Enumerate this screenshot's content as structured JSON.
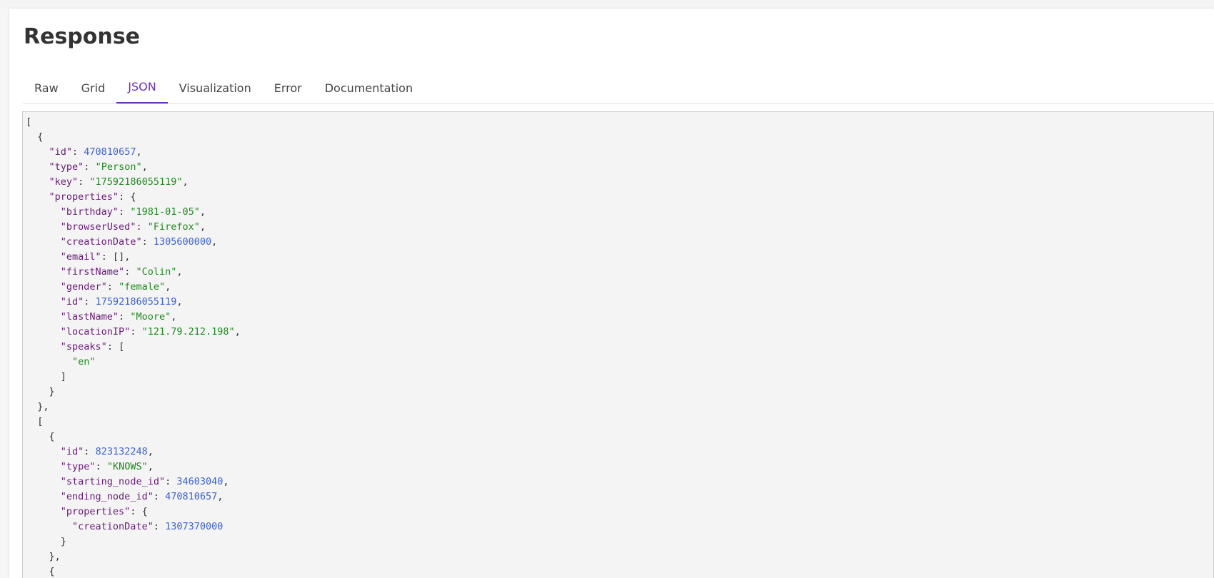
{
  "panel": {
    "title": "Response"
  },
  "tabs": [
    {
      "label": "Raw",
      "active": false
    },
    {
      "label": "Grid",
      "active": false
    },
    {
      "label": "JSON",
      "active": true
    },
    {
      "label": "Visualization",
      "active": false
    },
    {
      "label": "Error",
      "active": false
    },
    {
      "label": "Documentation",
      "active": false
    }
  ],
  "colors": {
    "accent": "#6b2fbf",
    "json_key": "#6a1b7a",
    "json_string": "#1d8a1d",
    "json_number": "#3b62d6"
  },
  "json_lines": [
    [
      {
        "t": "p",
        "v": "["
      }
    ],
    [
      {
        "t": "p",
        "v": "  {"
      }
    ],
    [
      {
        "t": "p",
        "v": "    "
      },
      {
        "t": "k",
        "v": "\"id\""
      },
      {
        "t": "p",
        "v": ": "
      },
      {
        "t": "n",
        "v": "470810657"
      },
      {
        "t": "p",
        "v": ","
      }
    ],
    [
      {
        "t": "p",
        "v": "    "
      },
      {
        "t": "k",
        "v": "\"type\""
      },
      {
        "t": "p",
        "v": ": "
      },
      {
        "t": "s",
        "v": "\"Person\""
      },
      {
        "t": "p",
        "v": ","
      }
    ],
    [
      {
        "t": "p",
        "v": "    "
      },
      {
        "t": "k",
        "v": "\"key\""
      },
      {
        "t": "p",
        "v": ": "
      },
      {
        "t": "s",
        "v": "\"17592186055119\""
      },
      {
        "t": "p",
        "v": ","
      }
    ],
    [
      {
        "t": "p",
        "v": "    "
      },
      {
        "t": "k",
        "v": "\"properties\""
      },
      {
        "t": "p",
        "v": ": {"
      }
    ],
    [
      {
        "t": "p",
        "v": "      "
      },
      {
        "t": "k",
        "v": "\"birthday\""
      },
      {
        "t": "p",
        "v": ": "
      },
      {
        "t": "s",
        "v": "\"1981-01-05\""
      },
      {
        "t": "p",
        "v": ","
      }
    ],
    [
      {
        "t": "p",
        "v": "      "
      },
      {
        "t": "k",
        "v": "\"browserUsed\""
      },
      {
        "t": "p",
        "v": ": "
      },
      {
        "t": "s",
        "v": "\"Firefox\""
      },
      {
        "t": "p",
        "v": ","
      }
    ],
    [
      {
        "t": "p",
        "v": "      "
      },
      {
        "t": "k",
        "v": "\"creationDate\""
      },
      {
        "t": "p",
        "v": ": "
      },
      {
        "t": "n",
        "v": "1305600000"
      },
      {
        "t": "p",
        "v": ","
      }
    ],
    [
      {
        "t": "p",
        "v": "      "
      },
      {
        "t": "k",
        "v": "\"email\""
      },
      {
        "t": "p",
        "v": ": [],"
      }
    ],
    [
      {
        "t": "p",
        "v": "      "
      },
      {
        "t": "k",
        "v": "\"firstName\""
      },
      {
        "t": "p",
        "v": ": "
      },
      {
        "t": "s",
        "v": "\"Colin\""
      },
      {
        "t": "p",
        "v": ","
      }
    ],
    [
      {
        "t": "p",
        "v": "      "
      },
      {
        "t": "k",
        "v": "\"gender\""
      },
      {
        "t": "p",
        "v": ": "
      },
      {
        "t": "s",
        "v": "\"female\""
      },
      {
        "t": "p",
        "v": ","
      }
    ],
    [
      {
        "t": "p",
        "v": "      "
      },
      {
        "t": "k",
        "v": "\"id\""
      },
      {
        "t": "p",
        "v": ": "
      },
      {
        "t": "n",
        "v": "17592186055119"
      },
      {
        "t": "p",
        "v": ","
      }
    ],
    [
      {
        "t": "p",
        "v": "      "
      },
      {
        "t": "k",
        "v": "\"lastName\""
      },
      {
        "t": "p",
        "v": ": "
      },
      {
        "t": "s",
        "v": "\"Moore\""
      },
      {
        "t": "p",
        "v": ","
      }
    ],
    [
      {
        "t": "p",
        "v": "      "
      },
      {
        "t": "k",
        "v": "\"locationIP\""
      },
      {
        "t": "p",
        "v": ": "
      },
      {
        "t": "s",
        "v": "\"121.79.212.198\""
      },
      {
        "t": "p",
        "v": ","
      }
    ],
    [
      {
        "t": "p",
        "v": "      "
      },
      {
        "t": "k",
        "v": "\"speaks\""
      },
      {
        "t": "p",
        "v": ": ["
      }
    ],
    [
      {
        "t": "p",
        "v": "        "
      },
      {
        "t": "s",
        "v": "\"en\""
      }
    ],
    [
      {
        "t": "p",
        "v": "      ]"
      }
    ],
    [
      {
        "t": "p",
        "v": "    }"
      }
    ],
    [
      {
        "t": "p",
        "v": "  },"
      }
    ],
    [
      {
        "t": "p",
        "v": "  ["
      }
    ],
    [
      {
        "t": "p",
        "v": "    {"
      }
    ],
    [
      {
        "t": "p",
        "v": "      "
      },
      {
        "t": "k",
        "v": "\"id\""
      },
      {
        "t": "p",
        "v": ": "
      },
      {
        "t": "n",
        "v": "823132248"
      },
      {
        "t": "p",
        "v": ","
      }
    ],
    [
      {
        "t": "p",
        "v": "      "
      },
      {
        "t": "k",
        "v": "\"type\""
      },
      {
        "t": "p",
        "v": ": "
      },
      {
        "t": "s",
        "v": "\"KNOWS\""
      },
      {
        "t": "p",
        "v": ","
      }
    ],
    [
      {
        "t": "p",
        "v": "      "
      },
      {
        "t": "k",
        "v": "\"starting_node_id\""
      },
      {
        "t": "p",
        "v": ": "
      },
      {
        "t": "n",
        "v": "34603040"
      },
      {
        "t": "p",
        "v": ","
      }
    ],
    [
      {
        "t": "p",
        "v": "      "
      },
      {
        "t": "k",
        "v": "\"ending_node_id\""
      },
      {
        "t": "p",
        "v": ": "
      },
      {
        "t": "n",
        "v": "470810657"
      },
      {
        "t": "p",
        "v": ","
      }
    ],
    [
      {
        "t": "p",
        "v": "      "
      },
      {
        "t": "k",
        "v": "\"properties\""
      },
      {
        "t": "p",
        "v": ": {"
      }
    ],
    [
      {
        "t": "p",
        "v": "        "
      },
      {
        "t": "k",
        "v": "\"creationDate\""
      },
      {
        "t": "p",
        "v": ": "
      },
      {
        "t": "n",
        "v": "1307370000"
      }
    ],
    [
      {
        "t": "p",
        "v": "      }"
      }
    ],
    [
      {
        "t": "p",
        "v": "    },"
      }
    ],
    [
      {
        "t": "p",
        "v": "    {"
      }
    ]
  ]
}
